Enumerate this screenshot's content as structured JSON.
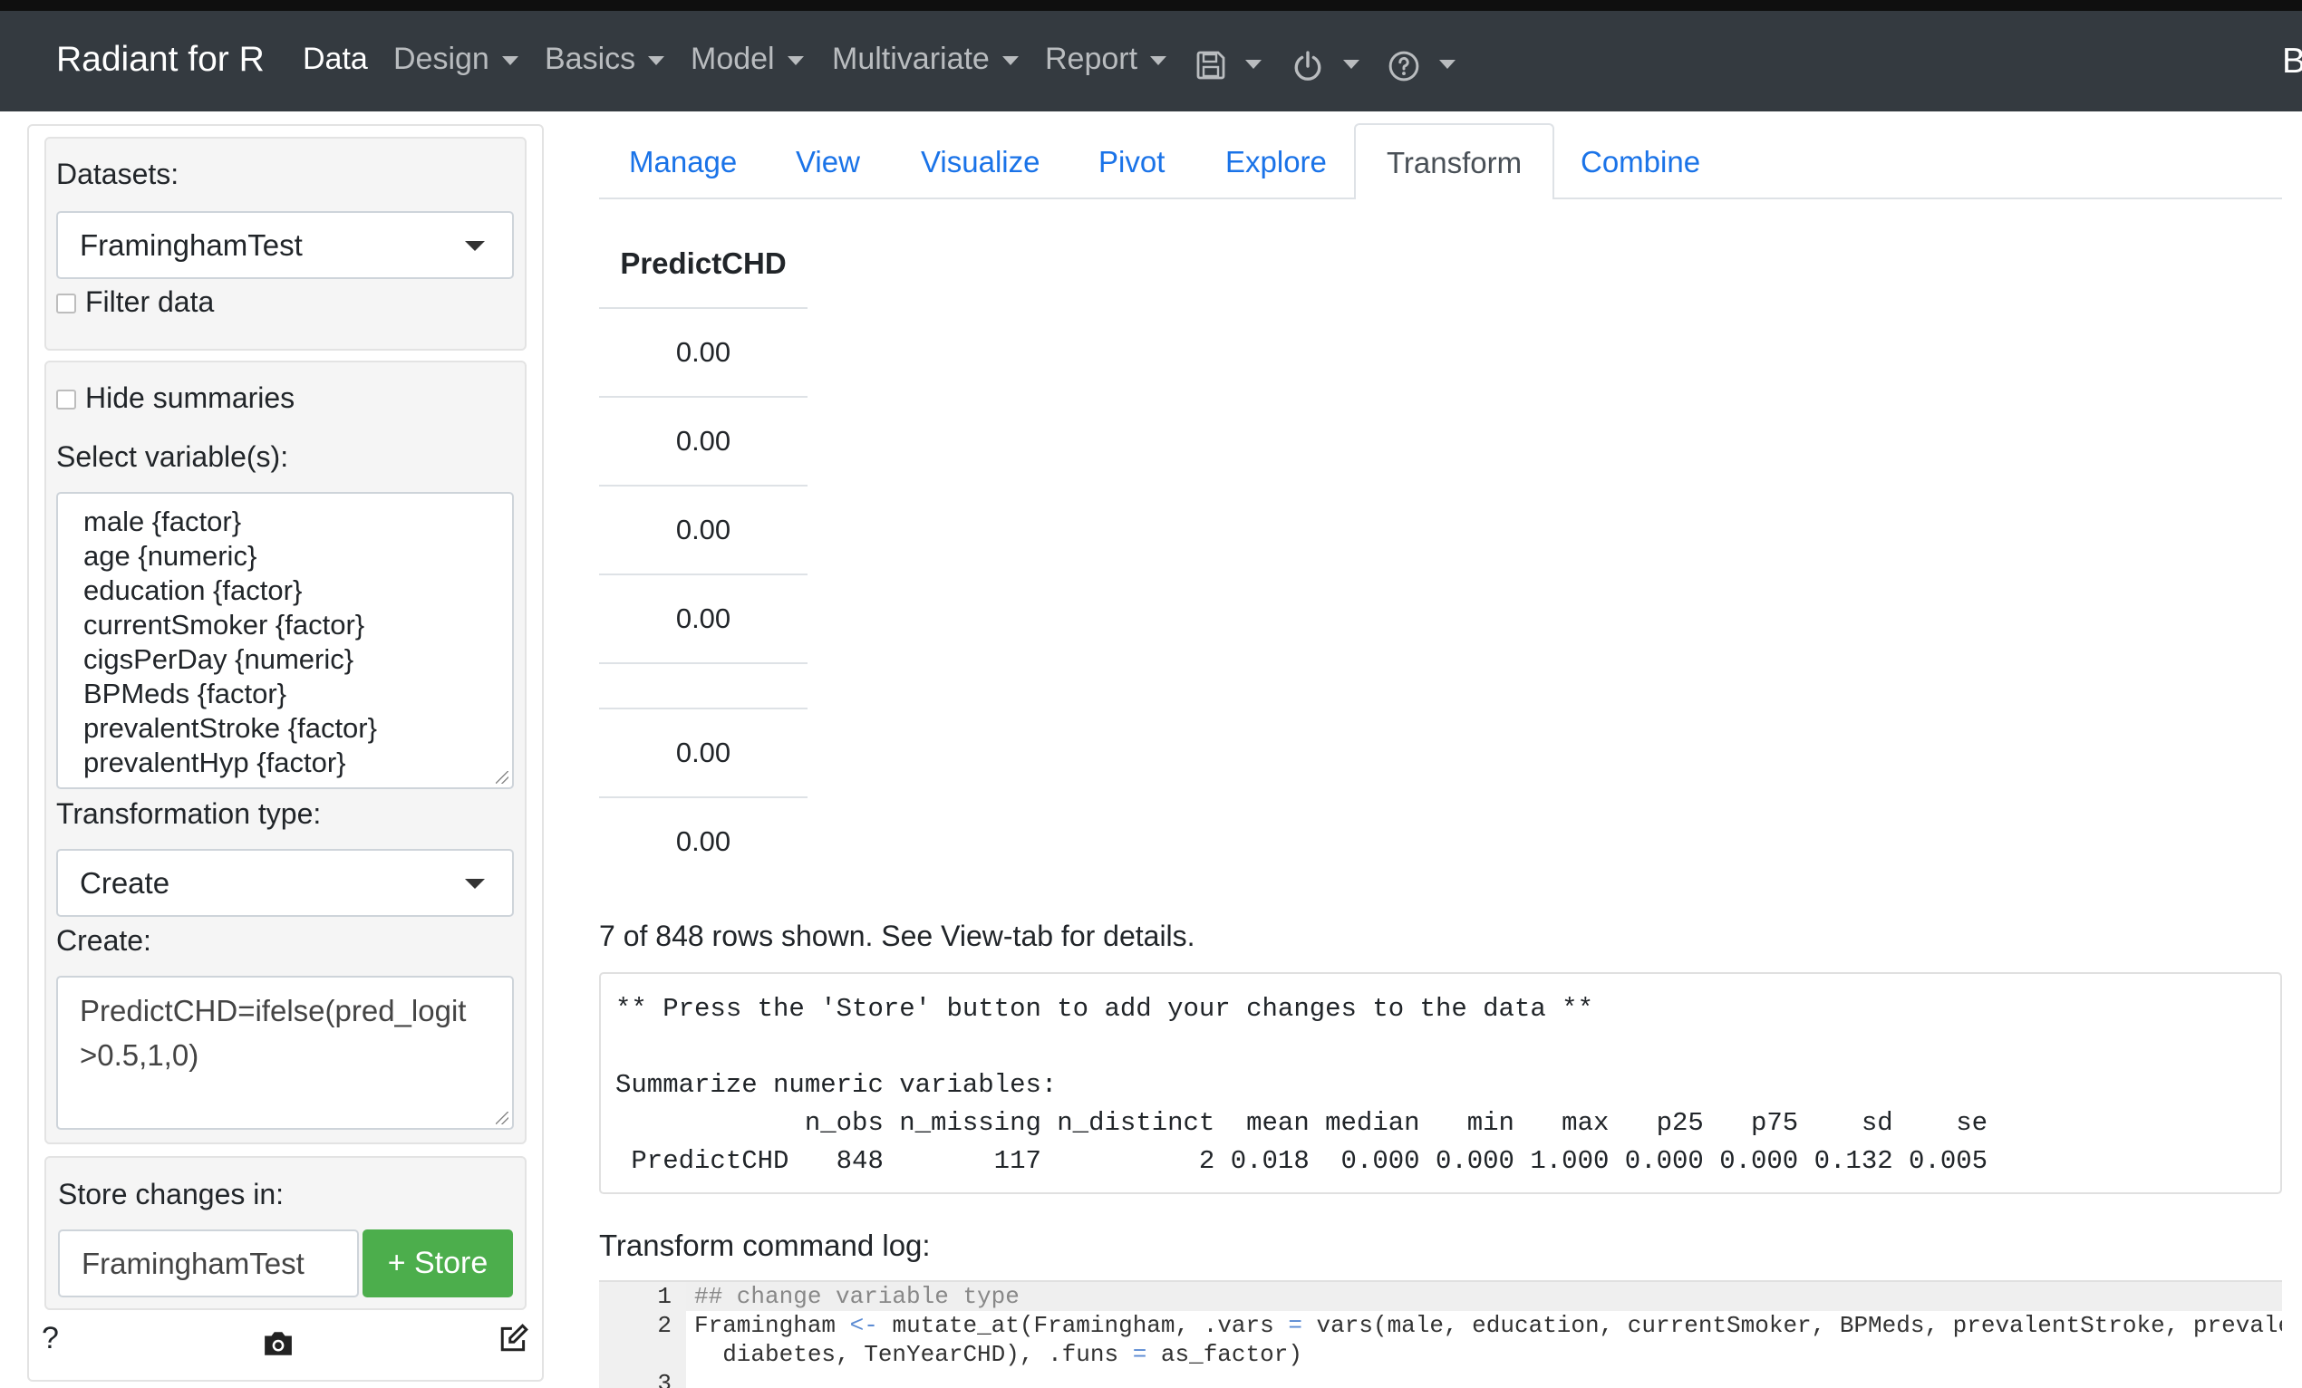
{
  "navbar": {
    "brand": "Radiant for R",
    "items": [
      {
        "label": "Data",
        "active": true
      },
      {
        "label": "Design"
      },
      {
        "label": "Basics"
      },
      {
        "label": "Model"
      },
      {
        "label": "Multivariate"
      },
      {
        "label": "Report"
      }
    ],
    "icons": [
      "save-icon",
      "power-icon",
      "help-icon"
    ],
    "right_letter": "B"
  },
  "sidebar": {
    "datasets_label": "Datasets:",
    "dataset_value": "FraminghamTest",
    "filter_label": "Filter data",
    "hide_summaries_label": "Hide summaries",
    "select_vars_label": "Select variable(s):",
    "variables": [
      "male {factor}",
      "age {numeric}",
      "education {factor}",
      "currentSmoker {factor}",
      "cigsPerDay {numeric}",
      "BPMeds {factor}",
      "prevalentStroke {factor}",
      "prevalentHyp {factor}"
    ],
    "transform_type_label": "Transformation type:",
    "transform_type_value": "Create",
    "create_label": "Create:",
    "create_value": "PredictCHD=ifelse(pred_logit >0.5,1,0)",
    "store_label": "Store changes in:",
    "store_value": "FraminghamTest",
    "store_button": "+ Store",
    "help_mark": "?"
  },
  "tabs": [
    "Manage",
    "View",
    "Visualize",
    "Pivot",
    "Explore",
    "Transform",
    "Combine"
  ],
  "active_tab": "Transform",
  "table": {
    "header": "PredictCHD",
    "rows": [
      "0.00",
      "0.00",
      "0.00",
      "0.00",
      "",
      "0.00",
      "0.00"
    ]
  },
  "rows_note": "7 of 848 rows shown. See View-tab for details.",
  "summary_text": "** Press the 'Store' button to add your changes to the data **\n\nSummarize numeric variables:\n            n_obs n_missing n_distinct  mean median   min   max   p25   p75    sd    se\n PredictCHD   848       117          2 0.018  0.000 0.000 1.000 0.000 0.000 0.132 0.005",
  "log_title": "Transform command log:",
  "code": {
    "line_numbers": [
      "1",
      "2",
      "",
      "3"
    ],
    "line1": "## change variable type",
    "line2a": "Framingham ",
    "assign_op": "<-",
    "line2b": " mutate_at(Framingham, .vars ",
    "eq_op": "=",
    "line2c": " vars(male, education, currentSmoker, BPMeds, prevalentStroke, prevalentHyp,",
    "line2d": "  diabetes, TenYearCHD), .funs ",
    "line2e": " as_factor)"
  }
}
